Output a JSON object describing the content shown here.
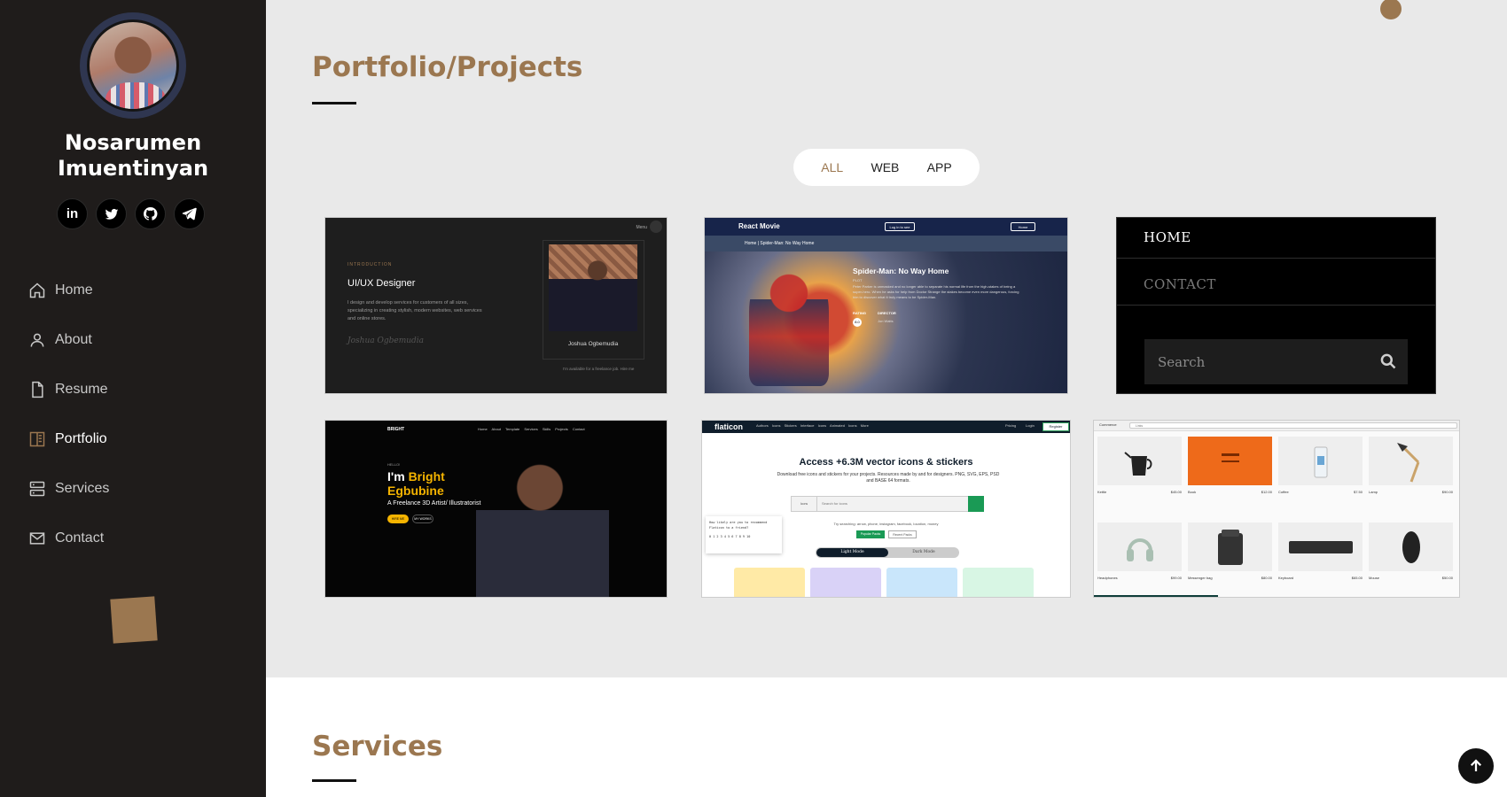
{
  "profile": {
    "first_name": "Nosarumen",
    "last_name": "Imuentinyan"
  },
  "socials": [
    {
      "name": "linkedin-icon",
      "glyph": "in"
    },
    {
      "name": "twitter-icon",
      "glyph": "t"
    },
    {
      "name": "github-icon",
      "glyph": "gh"
    },
    {
      "name": "telegram-icon",
      "glyph": "tg"
    }
  ],
  "nav": {
    "items": [
      {
        "label": "Home",
        "icon": "home-icon",
        "active": false
      },
      {
        "label": "About",
        "icon": "user-icon",
        "active": false
      },
      {
        "label": "Resume",
        "icon": "document-icon",
        "active": false
      },
      {
        "label": "Portfolio",
        "icon": "book-icon",
        "active": true
      },
      {
        "label": "Services",
        "icon": "server-icon",
        "active": false
      },
      {
        "label": "Contact",
        "icon": "envelope-icon",
        "active": false
      }
    ]
  },
  "colors": {
    "accent": "#9b7750",
    "sidebar_bg": "#1f1c1b",
    "main_bg": "#e9e9e9"
  },
  "portfolio": {
    "title": "Portfolio/Projects",
    "filters": [
      "ALL",
      "WEB",
      "APP"
    ],
    "active_filter": "ALL"
  },
  "projects": {
    "uiux": {
      "intro": "INTRODUCTION",
      "role": "UI/UX Designer",
      "desc": "I design and develop services for customers of all sizes, specializing in creating stylish, modern websites, web services and online stores.",
      "signature": "Joshua Ogbemudia",
      "person_name": "Joshua Ogbemudia",
      "menu": "Menu",
      "availability": "I'm available for a freelance job. Hire me"
    },
    "movies": {
      "logo": "React Movie",
      "login": "Log in to see",
      "home": "Home",
      "breadcrumb": "Home | Spider-Man: No Way Home",
      "title": "Spider-Man: No Way Home",
      "plot_label": "PLOT",
      "plot": "Peter Parker is unmasked and no longer able to separate his normal life from the high-stakes of being a super-hero. When he asks for help from Doctor Strange the stakes become even more dangerous, forcing him to discover what it truly means to be Spider-Man.",
      "rating_label": "RATING",
      "director_label": "DIRECTOR",
      "rating": "8.0",
      "director": "Jon Watts"
    },
    "menu": {
      "home": "HOME",
      "contact": "CONTACT",
      "search": "Search"
    },
    "bright": {
      "brand": "BRIGHT",
      "links": "Home About Template Services Skills Projects Contact",
      "hello": "HELLO!",
      "im": "I'm",
      "first": "Bright",
      "last": "Egbubine",
      "subtitle": "A Freelance 3D Artist/ Illustratorist",
      "hire": "HIRE ME",
      "work": "MY WORKS"
    },
    "flaticon": {
      "logo": "flaticon",
      "nav": "Authors Icons Stickers Interface Icons Animated Icons More",
      "pricing": "Pricing",
      "login": "Login",
      "register": "Register",
      "headline": "Access +6.3M vector icons & stickers",
      "subline": "Download free icons and stickers for your projects. Resources made by and for designers. PNG, SVG, EPS, PSD and BASE 64 formats.",
      "search_type": "Icons",
      "search_placeholder": "Search for icons",
      "small": "Try searching: arrow, phone, instagram, facebook, location, money",
      "popular": "Popular Packs",
      "recent": "Recent Packs",
      "light": "Light Mode",
      "dark": "Dark Mode",
      "poll": "How likely are you to recommend Flaticon to a friend?",
      "poll_scale": "0 1 2 3 4 5 6 7 8 9 10"
    },
    "commerce": {
      "brand": "Commerce",
      "search": "Links",
      "items": [
        {
          "label": "Kettle",
          "price": "$45.00"
        },
        {
          "label": "Book",
          "price": "$12.00"
        },
        {
          "label": "Coffee",
          "price": "$7.50"
        },
        {
          "label": "Lamp",
          "price": "$90.00"
        },
        {
          "label": "Headphones",
          "price": "$99.00"
        },
        {
          "label": "Messenger bag",
          "price": "$80.00"
        },
        {
          "label": "Keyboard",
          "price": "$65.00"
        },
        {
          "label": "Mouse",
          "price": "$50.00"
        }
      ]
    }
  },
  "services": {
    "title": "Services"
  }
}
